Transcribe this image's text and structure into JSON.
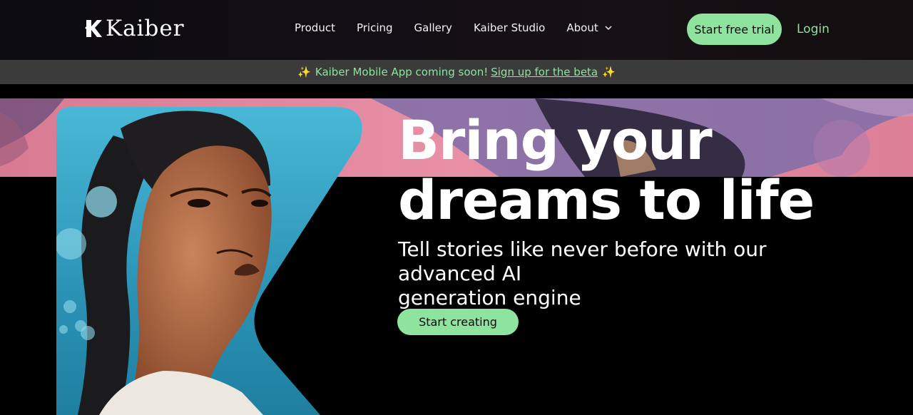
{
  "nav": {
    "logo_text": "Kaiber",
    "links": [
      "Product",
      "Pricing",
      "Gallery",
      "Kaiber Studio",
      "About"
    ],
    "trial_label": "Start free trial",
    "login_label": "Login"
  },
  "banner": {
    "text": "Kaiber Mobile App coming soon!",
    "link_text": "Sign up for the beta",
    "spark": "✨"
  },
  "hero": {
    "headline_line1": "Bring your",
    "headline_line2": "dreams to life",
    "subtitle_line1": "Tell stories like never before with our advanced AI",
    "subtitle_line2": "generation engine",
    "cta_label": "Start creating"
  },
  "colors": {
    "accent": "#8ee39f",
    "banner_bg": "#3b3b3b",
    "nav_bg": "#0f0c10",
    "hero_art_pink": "#e58aa0",
    "hero_art_purple": "#7e6da8",
    "portrait_bg": "#2fa3c4"
  },
  "icons": {
    "logo": "kaiber-k-icon",
    "about_dropdown": "chevron-down-icon",
    "sparkle": "sparkle-icon"
  }
}
